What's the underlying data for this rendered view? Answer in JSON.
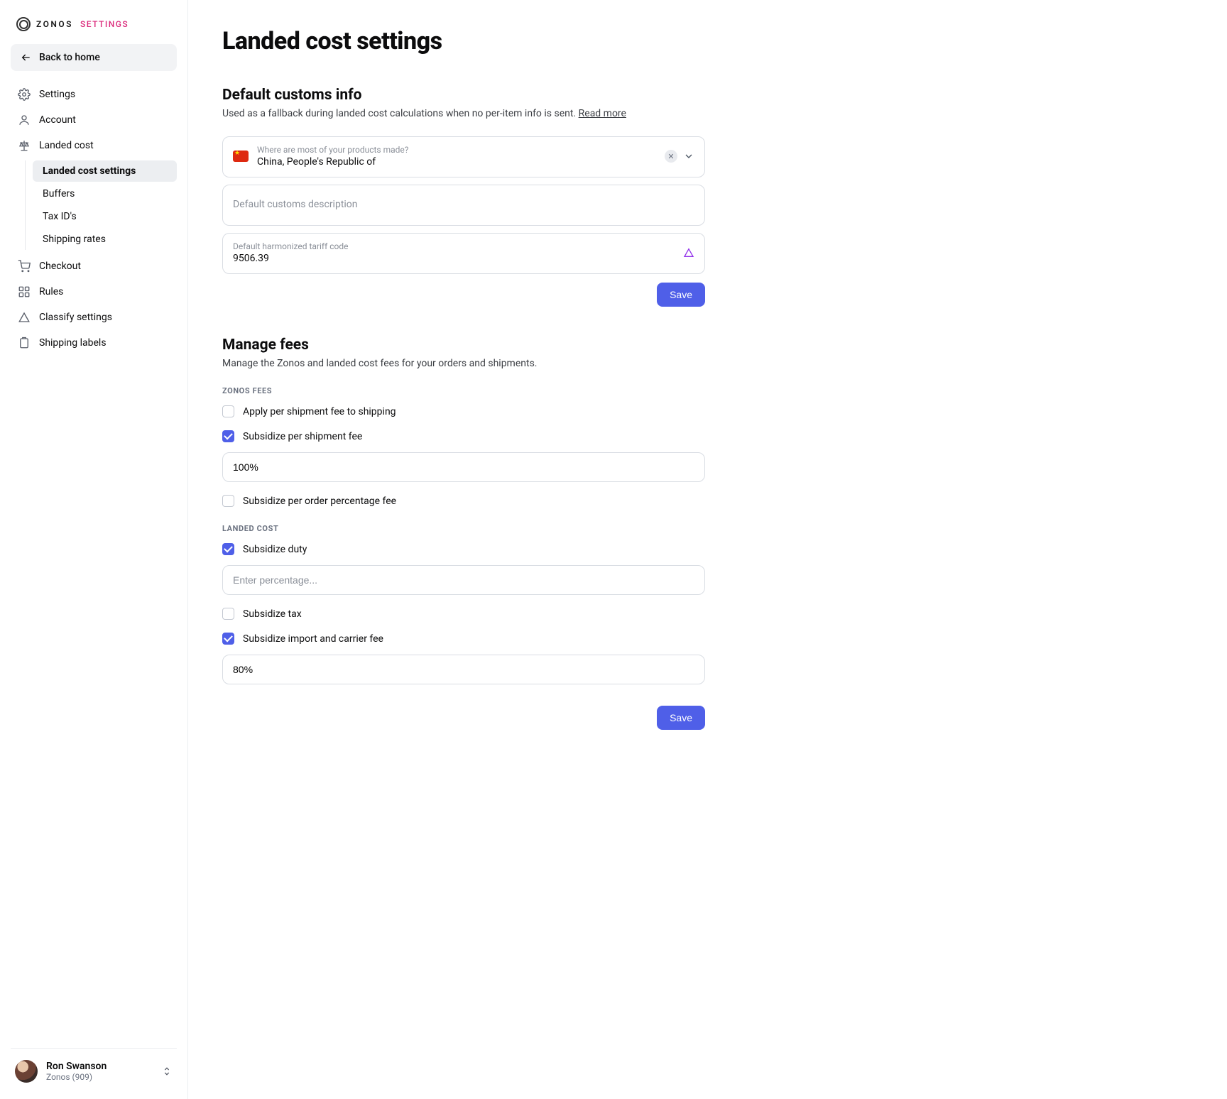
{
  "brand": {
    "name": "ZONOS",
    "sublabel": "SETTINGS"
  },
  "sidebar": {
    "back_label": "Back to home",
    "items": [
      {
        "label": "Settings"
      },
      {
        "label": "Account"
      },
      {
        "label": "Landed cost"
      },
      {
        "label": "Checkout"
      },
      {
        "label": "Rules"
      },
      {
        "label": "Classify settings"
      },
      {
        "label": "Shipping labels"
      }
    ],
    "landed_cost_children": [
      {
        "label": "Landed cost settings"
      },
      {
        "label": "Buffers"
      },
      {
        "label": "Tax ID's"
      },
      {
        "label": "Shipping rates"
      }
    ]
  },
  "user": {
    "name": "Ron Swanson",
    "org": "Zonos (909)"
  },
  "page": {
    "title": "Landed cost settings",
    "section1": {
      "heading": "Default customs info",
      "description": "Used as a fallback during landed cost calculations when no per-item info is sent.",
      "read_more": "Read more",
      "origin_label": "Where are most of your products made?",
      "origin_value": "China, People's Republic of",
      "customs_desc_placeholder": "Default customs description",
      "hts_label": "Default harmonized tariff code",
      "hts_value": "9506.39",
      "save_label": "Save"
    },
    "section2": {
      "heading": "Manage fees",
      "description": "Manage the Zonos and landed cost fees for your orders and shipments.",
      "zonos_fees_label": "ZONOS FEES",
      "apply_per_shipment_label": "Apply per shipment fee to shipping",
      "subsidize_per_shipment_label": "Subsidize per shipment fee",
      "subsidize_per_shipment_value": "100%",
      "subsidize_per_order_label": "Subsidize per order percentage fee",
      "landed_cost_label": "LANDED COST",
      "subsidize_duty_label": "Subsidize duty",
      "duty_percentage_placeholder": "Enter percentage...",
      "subsidize_tax_label": "Subsidize tax",
      "subsidize_import_label": "Subsidize import and carrier fee",
      "subsidize_import_value": "80%",
      "save_label": "Save"
    }
  }
}
